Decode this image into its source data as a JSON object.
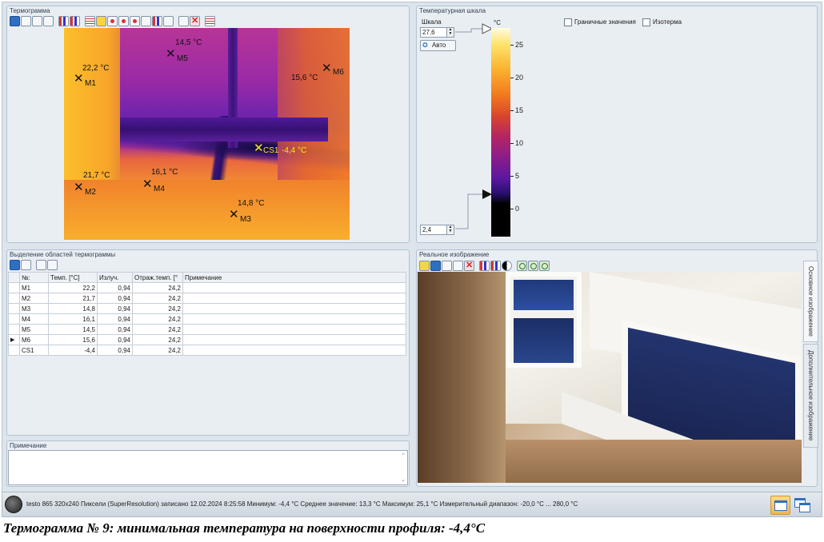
{
  "thermogram": {
    "title": "Термограмма",
    "markers": [
      {
        "id": "M1",
        "temp": "22,2 °C"
      },
      {
        "id": "M5",
        "temp": "14,5 °C"
      },
      {
        "id": "M6",
        "temp": "15,6 °C"
      },
      {
        "id": "M2",
        "temp": "21,7 °C"
      },
      {
        "id": "M4",
        "temp": "16,1 °C"
      },
      {
        "id": "M3",
        "temp": "14,8 °C"
      },
      {
        "id": "CS1",
        "temp": "-4,4 °C"
      }
    ]
  },
  "scale": {
    "title": "Температурная шкала",
    "scale_label": "Шкала",
    "max_value": "27,6",
    "min_value": "2,4",
    "auto_label": "Авто",
    "unit": "°C",
    "ticks": [
      "25",
      "20",
      "15",
      "10",
      "5",
      "0"
    ],
    "boundary_label": "Граничные значения",
    "isotherm_label": "Изотерма"
  },
  "regions": {
    "title": "Выделение областей термограммы",
    "columns": [
      "№:",
      "Темп. [°C]",
      "Излуч.",
      "Отраж.темп. [°",
      "Примечание"
    ],
    "rows": [
      {
        "id": "M1",
        "temp": "22,2",
        "emiss": "0,94",
        "refl": "24,2"
      },
      {
        "id": "M2",
        "temp": "21,7",
        "emiss": "0,94",
        "refl": "24,2"
      },
      {
        "id": "M3",
        "temp": "14,8",
        "emiss": "0,94",
        "refl": "24,2"
      },
      {
        "id": "M4",
        "temp": "16,1",
        "emiss": "0,94",
        "refl": "24,2"
      },
      {
        "id": "M5",
        "temp": "14,5",
        "emiss": "0,94",
        "refl": "24,2"
      },
      {
        "id": "M6",
        "temp": "15,6",
        "emiss": "0,94",
        "refl": "24,2"
      },
      {
        "id": "CS1",
        "temp": "-4,4",
        "emiss": "0,94",
        "refl": "24,2"
      }
    ]
  },
  "note": {
    "title": "Примечание"
  },
  "real_image": {
    "title": "Реальное изображение",
    "tab_main": "Основное изображение",
    "tab_extra": "Дополнительное изображение"
  },
  "status": {
    "text": "testo 865 320x240 Пиксели (SuperResolution) записано 12.02.2024 8:25:58 Минимум: -4,4 °C Среднее значение: 13,3 °C Максимум: 25,1 °C Измерительный диапазон: -20,0 °C ... 280,0 °C"
  },
  "caption": "Термограмма № 9: минимальная температура на поверхности профиля: -4,4°С"
}
